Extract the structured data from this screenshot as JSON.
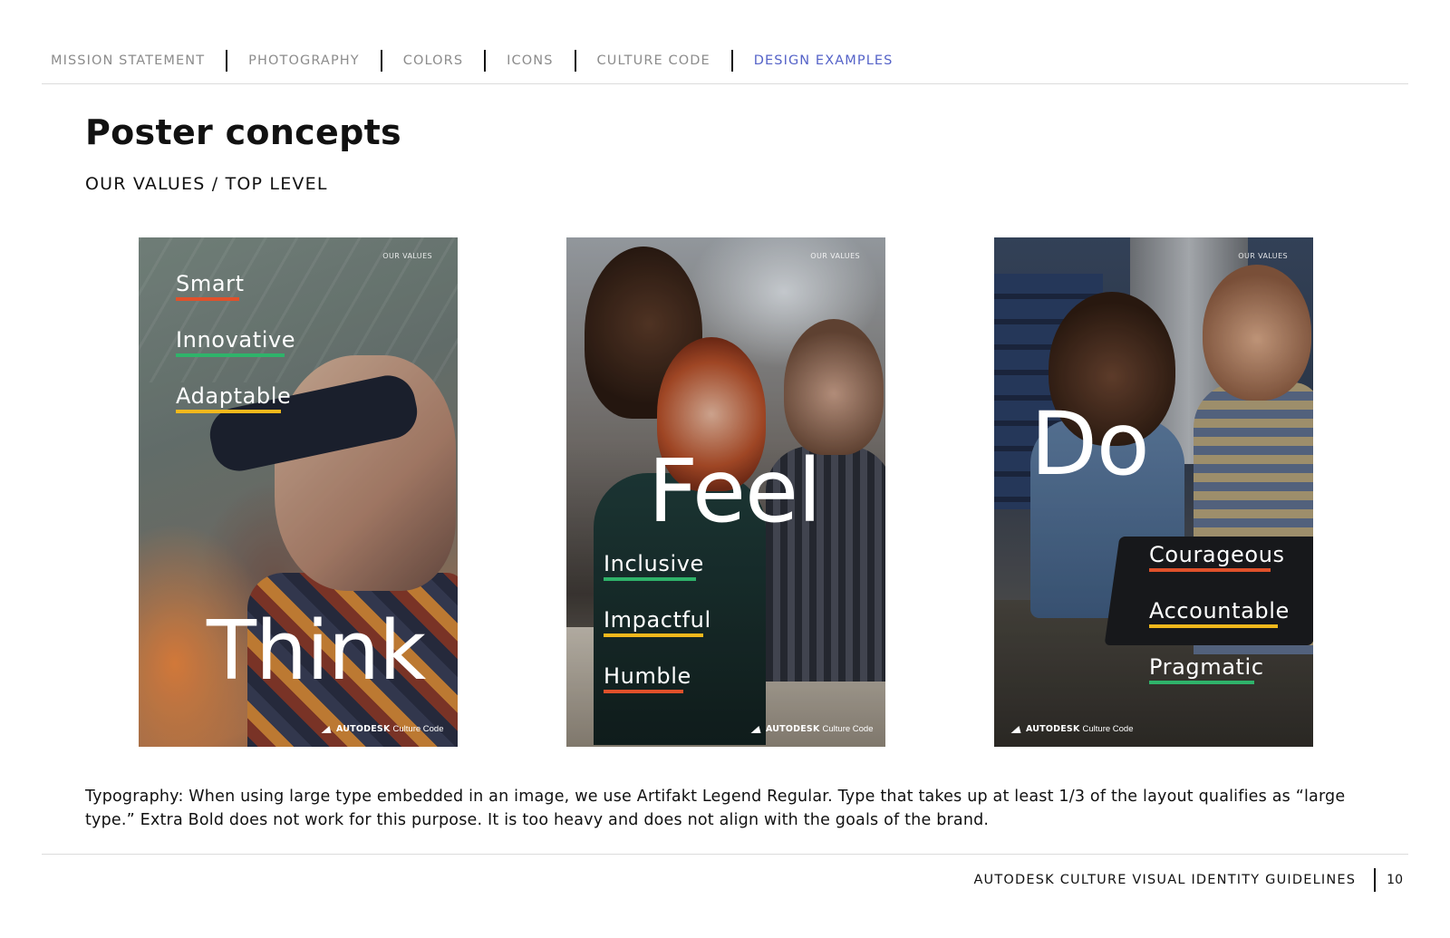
{
  "nav": {
    "items": [
      {
        "label": "MISSION STATEMENT",
        "active": false
      },
      {
        "label": "PHOTOGRAPHY",
        "active": false
      },
      {
        "label": "COLORS",
        "active": false
      },
      {
        "label": "ICONS",
        "active": false
      },
      {
        "label": "CULTURE CODE",
        "active": false
      },
      {
        "label": "DESIGN EXAMPLES",
        "active": true
      }
    ],
    "active_color": "#5563c8"
  },
  "page": {
    "title": "Poster concepts",
    "subtitle": "OUR VALUES / TOP LEVEL"
  },
  "posters": [
    {
      "tag": "OUR VALUES",
      "big_word": "Think",
      "values": [
        {
          "label": "Smart",
          "color": "#e0512b"
        },
        {
          "label": "Innovative",
          "color": "#2fb36a"
        },
        {
          "label": "Adaptable",
          "color": "#f2b81c"
        }
      ],
      "logo_brand": "AUTODESK",
      "logo_sub": "Culture Code"
    },
    {
      "tag": "OUR VALUES",
      "big_word": "Feel",
      "values": [
        {
          "label": "Inclusive",
          "color": "#2fb36a"
        },
        {
          "label": "Impactful",
          "color": "#f2b81c"
        },
        {
          "label": "Humble",
          "color": "#e0512b"
        }
      ],
      "logo_brand": "AUTODESK",
      "logo_sub": "Culture Code"
    },
    {
      "tag": "OUR VALUES",
      "big_word": "Do",
      "values": [
        {
          "label": "Courageous",
          "color": "#e0512b"
        },
        {
          "label": "Accountable",
          "color": "#f2b81c"
        },
        {
          "label": "Pragmatic",
          "color": "#2fb36a"
        }
      ],
      "logo_brand": "AUTODESK",
      "logo_sub": "Culture Code"
    }
  ],
  "body_text": "Typography: When using large type embedded in an image, we use Artifakt Legend Regular. Type that takes up at least 1/3 of the layout qualifies as “large type.” Extra Bold does not work for this purpose. It is too heavy and does not align with the goals of the brand.",
  "footer": {
    "title": "AUTODESK CULTURE VISUAL IDENTITY GUIDELINES",
    "page_number": "10"
  }
}
